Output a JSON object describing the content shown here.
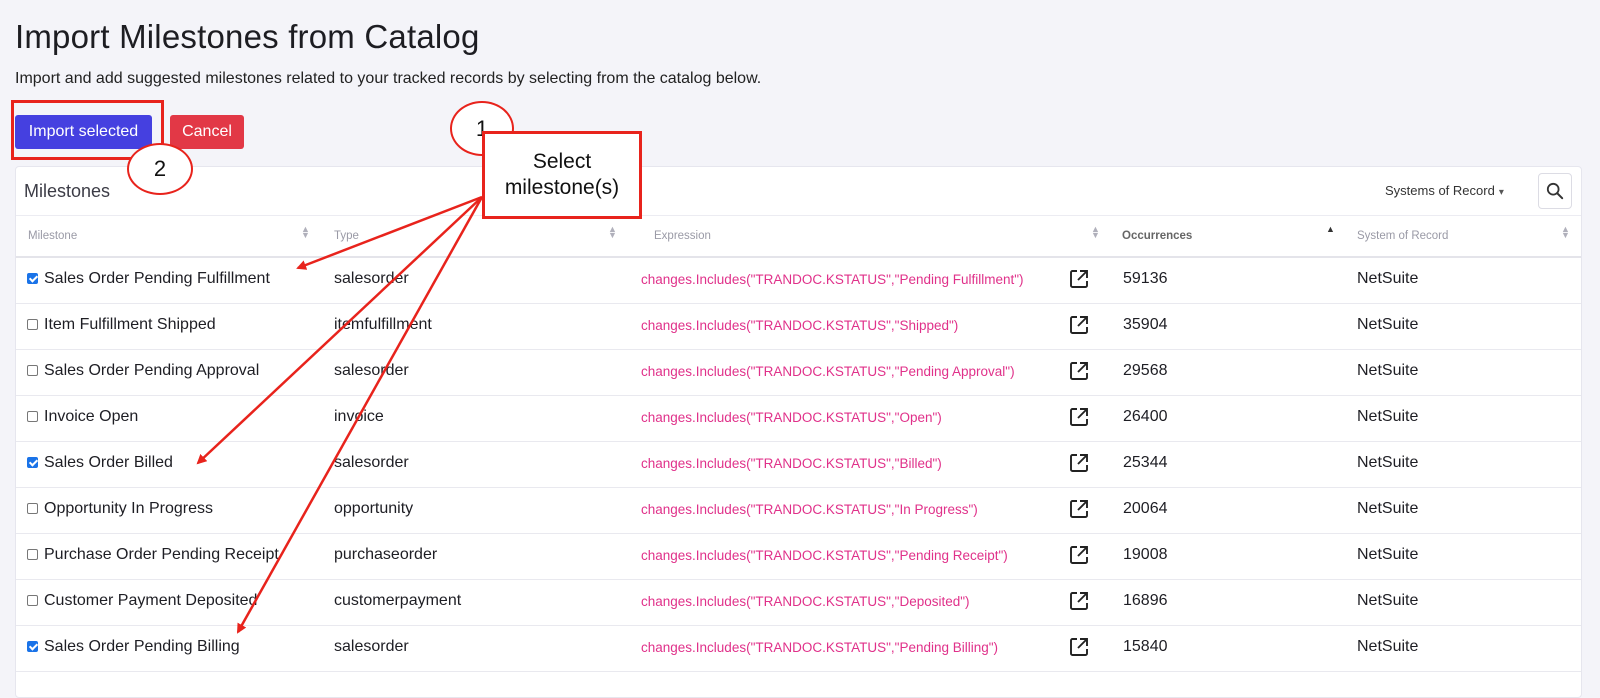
{
  "header": {
    "title": "Import Milestones from Catalog",
    "subtitle": "Import and add suggested milestones related to your tracked records by selecting from the catalog below."
  },
  "actions": {
    "import_label": "Import selected",
    "cancel_label": "Cancel"
  },
  "panel": {
    "title": "Milestones",
    "filter_label": "Systems of Record",
    "search_icon": "search-icon"
  },
  "columns": [
    "Milestone",
    "Type",
    "Expression",
    "Occurrences",
    "System of Record"
  ],
  "rows": [
    {
      "checked": true,
      "milestone": "Sales Order Pending Fulfillment",
      "type": "salesorder",
      "expression": "changes.Includes(\"TRANDOC.KSTATUS\",\"Pending Fulfillment\")",
      "occurrences": "59136",
      "system": "NetSuite"
    },
    {
      "checked": false,
      "milestone": "Item Fulfillment Shipped",
      "type": "itemfulfillment",
      "expression": "changes.Includes(\"TRANDOC.KSTATUS\",\"Shipped\")",
      "occurrences": "35904",
      "system": "NetSuite"
    },
    {
      "checked": false,
      "milestone": "Sales Order Pending Approval",
      "type": "salesorder",
      "expression": "changes.Includes(\"TRANDOC.KSTATUS\",\"Pending Approval\")",
      "occurrences": "29568",
      "system": "NetSuite"
    },
    {
      "checked": false,
      "milestone": "Invoice Open",
      "type": "invoice",
      "expression": "changes.Includes(\"TRANDOC.KSTATUS\",\"Open\")",
      "occurrences": "26400",
      "system": "NetSuite"
    },
    {
      "checked": true,
      "milestone": "Sales Order Billed",
      "type": "salesorder",
      "expression": "changes.Includes(\"TRANDOC.KSTATUS\",\"Billed\")",
      "occurrences": "25344",
      "system": "NetSuite"
    },
    {
      "checked": false,
      "milestone": "Opportunity In Progress",
      "type": "opportunity",
      "expression": "changes.Includes(\"TRANDOC.KSTATUS\",\"In Progress\")",
      "occurrences": "20064",
      "system": "NetSuite"
    },
    {
      "checked": false,
      "milestone": "Purchase Order Pending Receipt",
      "type": "purchaseorder",
      "expression": "changes.Includes(\"TRANDOC.KSTATUS\",\"Pending Receipt\")",
      "occurrences": "19008",
      "system": "NetSuite"
    },
    {
      "checked": false,
      "milestone": "Customer Payment Deposited",
      "type": "customerpayment",
      "expression": "changes.Includes(\"TRANDOC.KSTATUS\",\"Deposited\")",
      "occurrences": "16896",
      "system": "NetSuite"
    },
    {
      "checked": true,
      "milestone": "Sales Order Pending Billing",
      "type": "salesorder",
      "expression": "changes.Includes(\"TRANDOC.KSTATUS\",\"Pending Billing\")",
      "occurrences": "15840",
      "system": "NetSuite"
    }
  ],
  "annotations": {
    "step1_number": "1",
    "step1_text_line1": "Select",
    "step1_text_line2": "milestone(s)",
    "step2_number": "2",
    "color": "#e8231c"
  }
}
